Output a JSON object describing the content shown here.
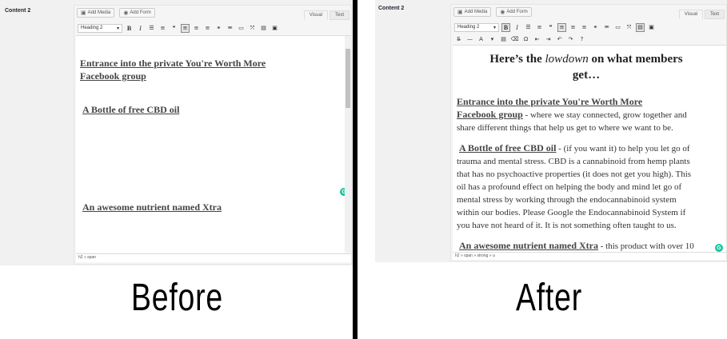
{
  "before": {
    "field_label": "Content 2",
    "add_media": "Add Media",
    "add_form": "Add Form",
    "tab_visual": "Visual",
    "tab_text": "Text",
    "format_select": "Heading 2",
    "heading1_line1": "Entrance into the private You're Worth More",
    "heading1_line2": "Facebook group",
    "heading2": "A Bottle of free CBD oil",
    "heading3": "An awesome nutrient named Xtra",
    "status_path": "h2 » span",
    "caption": "Before"
  },
  "after": {
    "field_label": "Content 2",
    "add_media": "Add Media",
    "add_form": "Add Form",
    "tab_visual": "Visual",
    "tab_text": "Text",
    "format_select": "Heading 2",
    "title_pre": "Here’s the ",
    "title_em": "lowdown",
    "title_post": " on what members",
    "title_line2": "get…",
    "heading1_line1": "Entrance into the private You're Worth More",
    "heading1_line2": "Facebook group",
    "para1_tail_line1": " - where we stay connected, grow together and",
    "para1_line2": "share different things that help us get to where we want to be.",
    "heading2": "A Bottle of free CBD oil",
    "para2_tail_line1": " - (if you want it) to help you let go of",
    "para2_lines": [
      "trauma and mental stress. CBD is a cannabinoid from hemp plants",
      "that has no psychoactive properties (it does not get you high). This",
      "oil has a profound effect on helping the body and mind let go of",
      "mental stress by working through the endocannabinoid system",
      "within our bodies. Please Google the Endocannabinoid System if",
      "you have not heard of it. It is not something often taught to us."
    ],
    "heading3": "An awesome nutrient named Xtra",
    "para3_tail_line1": " - this product with over 10",
    "status_path": "h2 » span » strong » u",
    "caption": "After"
  },
  "colors": {
    "grammarly": "#15c39a",
    "divider": "#000000"
  },
  "icons": [
    "add-media-icon",
    "add-form-icon",
    "bold-icon",
    "italic-icon",
    "bullet-list-icon",
    "numbered-list-icon",
    "blockquote-icon",
    "align-left-icon",
    "align-center-icon",
    "align-right-icon",
    "link-icon",
    "unlink-icon",
    "read-more-icon",
    "fullscreen-icon",
    "toolbar-toggle-icon",
    "add-form-toolbar-icon",
    "grammarly-icon"
  ]
}
